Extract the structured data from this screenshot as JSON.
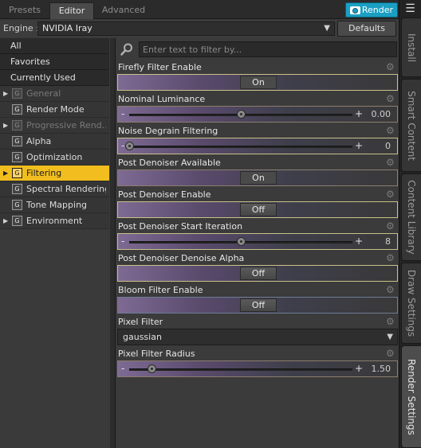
{
  "tabs": {
    "presets": "Presets",
    "editor": "Editor",
    "advanced": "Advanced",
    "render": "Render"
  },
  "engine": {
    "label": "Engine :",
    "value": "NVIDIA Iray",
    "defaults": "Defaults"
  },
  "side_tabs": {
    "install": "Install",
    "smart_content": "Smart Content",
    "content_library": "Content Library",
    "draw_settings": "Draw Settings",
    "render_settings": "Render Settings"
  },
  "categories": [
    "All",
    "Favorites",
    "Currently Used"
  ],
  "groups": [
    {
      "label": "General",
      "expandable": true,
      "dim": true
    },
    {
      "label": "Render Mode",
      "expandable": false
    },
    {
      "label": "Progressive Rend...",
      "expandable": true,
      "dim": true
    },
    {
      "label": "Alpha",
      "expandable": false
    },
    {
      "label": "Optimization",
      "expandable": false
    },
    {
      "label": "Filtering",
      "expandable": true,
      "active": true
    },
    {
      "label": "Spectral Rendering",
      "expandable": false
    },
    {
      "label": "Tone Mapping",
      "expandable": false
    },
    {
      "label": "Environment",
      "expandable": true
    }
  ],
  "group_icon_glyph": "G",
  "filter": {
    "placeholder": "Enter text to filter by..."
  },
  "properties": {
    "firefly": {
      "label": "Firefly Filter Enable",
      "state": "On"
    },
    "nominal": {
      "label": "Nominal Luminance",
      "value": "0.00",
      "fraction": 0.5,
      "minus": "-",
      "plus": "+"
    },
    "noise": {
      "label": "Noise Degrain Filtering",
      "value": "0",
      "fraction": 0.0,
      "minus": "-",
      "plus": "+"
    },
    "post_available": {
      "label": "Post Denoiser Available",
      "state": "On"
    },
    "post_enable": {
      "label": "Post Denoiser Enable",
      "state": "Off"
    },
    "post_start": {
      "label": "Post Denoiser Start Iteration",
      "value": "8",
      "fraction": 0.5,
      "minus": "-",
      "plus": "+"
    },
    "post_alpha": {
      "label": "Post Denoiser Denoise Alpha",
      "state": "Off"
    },
    "bloom": {
      "label": "Bloom Filter Enable",
      "state": "Off"
    },
    "pixel_filter": {
      "label": "Pixel Filter",
      "value": "gaussian"
    },
    "pixel_radius": {
      "label": "Pixel Filter Radius",
      "value": "1.50",
      "fraction": 0.1,
      "minus": "-",
      "plus": "+"
    }
  },
  "colors": {
    "accent": "#f2be1f",
    "render_button": "#1a9fc2"
  }
}
